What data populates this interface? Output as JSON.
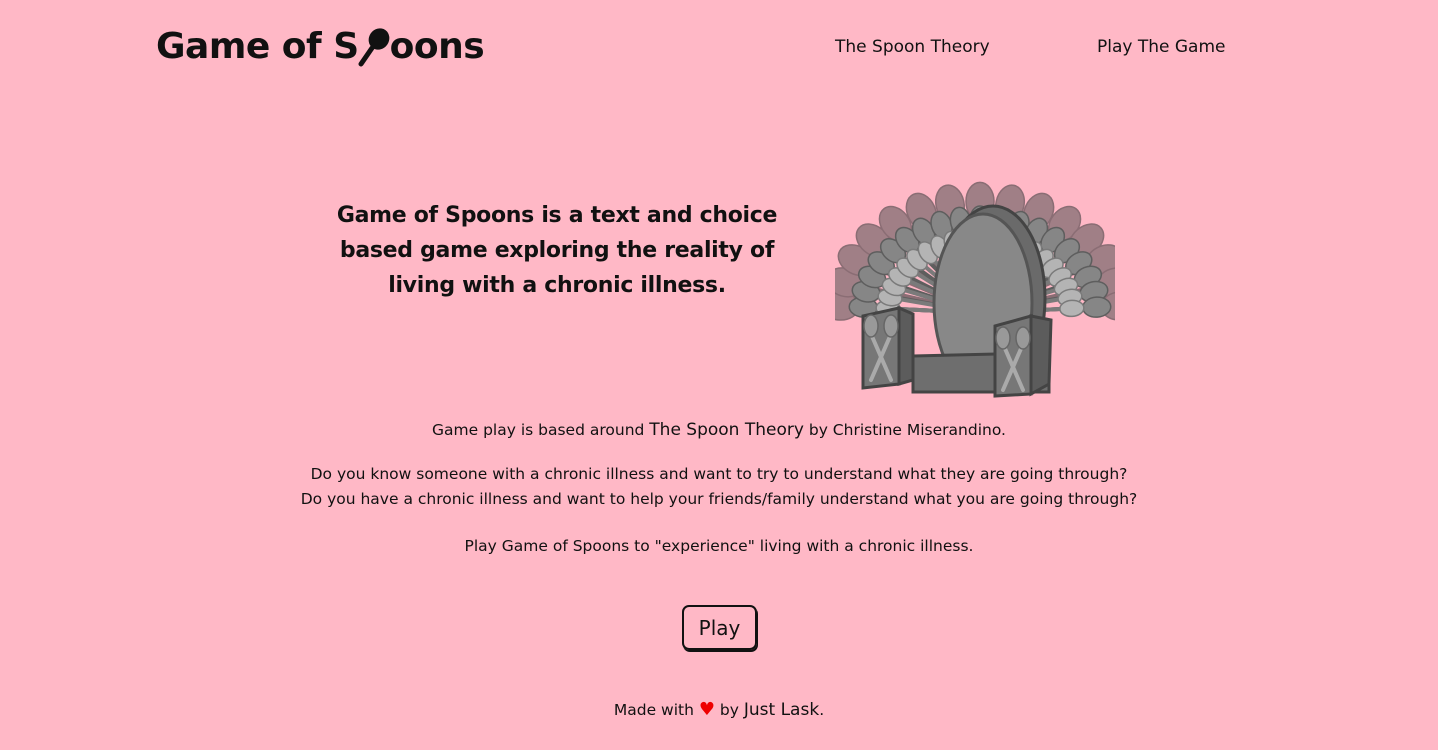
{
  "header": {
    "logo_before": "Game of S",
    "logo_after": "oons",
    "nav": {
      "spoon_theory": "The Spoon Theory",
      "play_game": "Play The Game"
    }
  },
  "hero": {
    "tagline": "Game of Spoons is a text and choice based game exploring the reality of living with a chronic illness.",
    "image": "iron-throne-of-spoons"
  },
  "intro": {
    "based_prefix": "Game play is based around ",
    "theory_link": "The Spoon Theory",
    "based_suffix": " by Christine Miserandino.",
    "question1": "Do you know someone with a chronic illness and want to try to understand what they are going through?",
    "question2": "Do you have a chronic illness and want to help your friends/family understand what you are going through?",
    "cta_text": "Play Game of Spoons to \"experience\" living with a chronic illness."
  },
  "play_button": "Play",
  "footer": {
    "prefix": "Made with ",
    "heart": "♥",
    "middle": " by ",
    "author": "Just Lask",
    "suffix": "."
  },
  "colors": {
    "background": "#ffb8c6",
    "text": "#111111",
    "heart": "#ee0000"
  }
}
